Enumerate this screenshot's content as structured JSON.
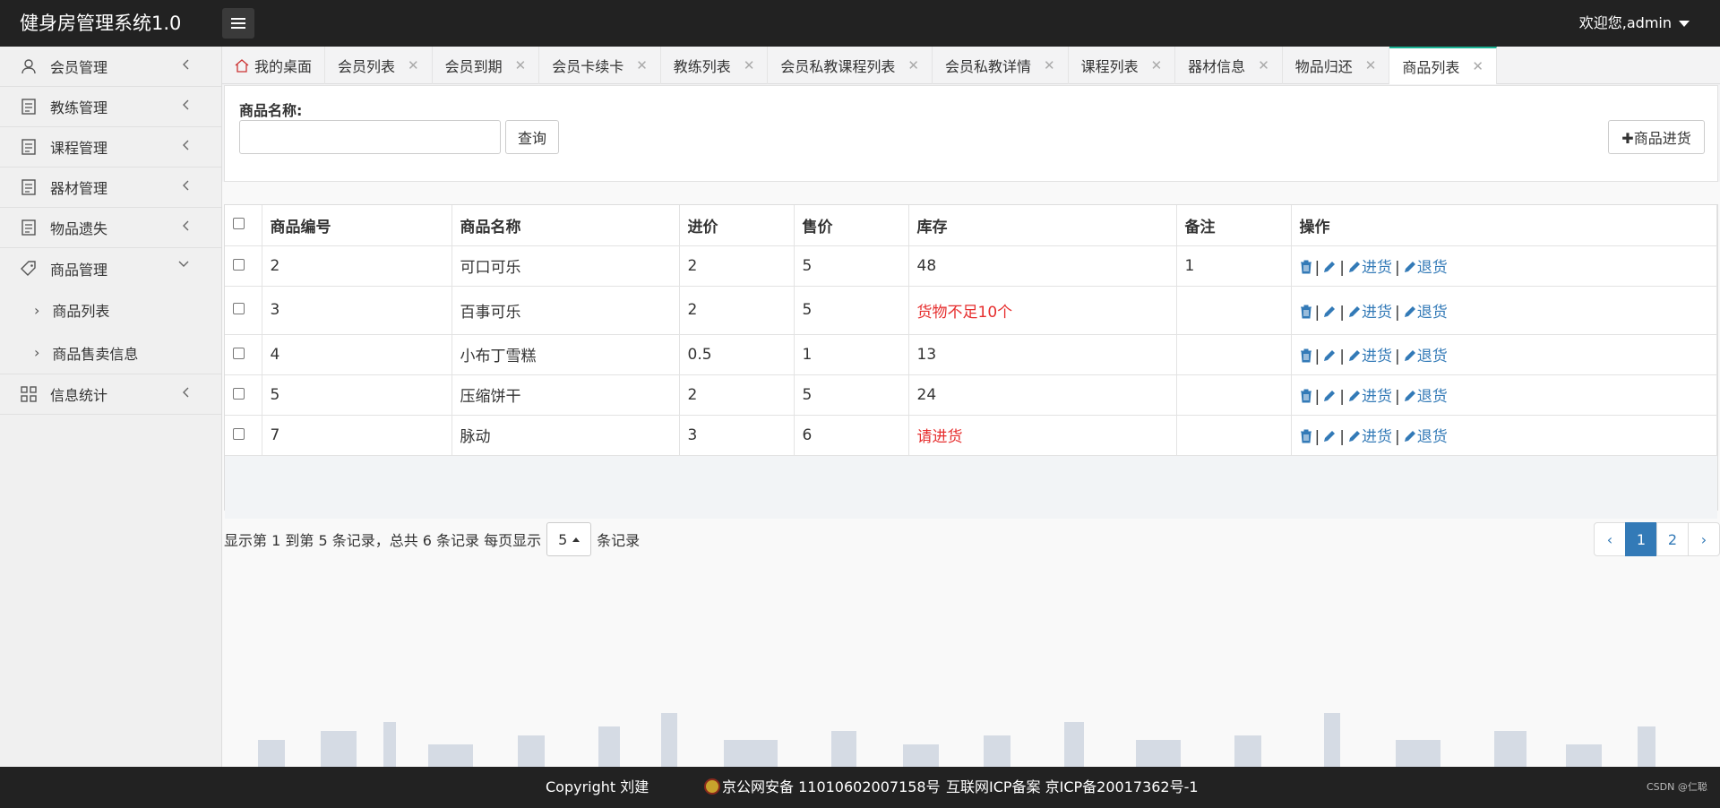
{
  "app": {
    "title": "健身房管理系统1.0",
    "user": "欢迎您,admin"
  },
  "sidebar": {
    "items": [
      {
        "label": "会员管理",
        "icon": "user-icon"
      },
      {
        "label": "教练管理",
        "icon": "document-icon"
      },
      {
        "label": "课程管理",
        "icon": "document-icon"
      },
      {
        "label": "器材管理",
        "icon": "document-icon"
      },
      {
        "label": "物品遗失",
        "icon": "document-icon"
      },
      {
        "label": "商品管理",
        "icon": "tag-icon",
        "expanded": true
      },
      {
        "label": "信息统计",
        "icon": "grid-icon"
      }
    ],
    "subitems": [
      {
        "label": "商品列表"
      },
      {
        "label": "商品售卖信息"
      }
    ]
  },
  "tabs": [
    {
      "label": "我的桌面"
    },
    {
      "label": "会员列表"
    },
    {
      "label": "会员到期"
    },
    {
      "label": "会员卡续卡"
    },
    {
      "label": "教练列表"
    },
    {
      "label": "会员私教课程列表"
    },
    {
      "label": "会员私教详情"
    },
    {
      "label": "课程列表"
    },
    {
      "label": "器材信息"
    },
    {
      "label": "物品归还"
    },
    {
      "label": "商品列表",
      "active": true
    }
  ],
  "search": {
    "label": "商品名称:",
    "value": "",
    "query_label": "查询",
    "restock_label": "✚商品进货"
  },
  "table": {
    "headers": [
      "商品编号",
      "商品名称",
      "进价",
      "售价",
      "库存",
      "备注",
      "操作"
    ],
    "rows": [
      {
        "id": "2",
        "name": "可口可乐",
        "cost": "2",
        "price": "5",
        "stock": "48",
        "stock_alert": false,
        "note": "1"
      },
      {
        "id": "3",
        "name": "百事可乐",
        "cost": "2",
        "price": "5",
        "stock": "货物不足10个",
        "stock_alert": true,
        "note": ""
      },
      {
        "id": "4",
        "name": "小布丁雪糕",
        "cost": "0.5",
        "price": "1",
        "stock": "13",
        "stock_alert": false,
        "note": ""
      },
      {
        "id": "5",
        "name": "压缩饼干",
        "cost": "2",
        "price": "5",
        "stock": "24",
        "stock_alert": false,
        "note": ""
      },
      {
        "id": "7",
        "name": "脉动",
        "cost": "3",
        "price": "6",
        "stock": "请进货",
        "stock_alert": true,
        "note": ""
      }
    ],
    "actions": {
      "restock": "进货",
      "return": "退货",
      "sep": "|"
    }
  },
  "pagination": {
    "info_prefix": "显示第 1 到第 5 条记录，总共 6 条记录 每页显示",
    "page_size": "5",
    "info_suffix": "条记录",
    "prev": "‹",
    "pages": [
      "1",
      "2"
    ],
    "current": "1",
    "next": "›"
  },
  "footer": {
    "copyright": "Copyright 刘建",
    "police": "京公网安备 11010602007158号",
    "icp": "互联网ICP备案 京ICP备20017362号-1",
    "watermark": "CSDN @仁聪"
  },
  "colors": {
    "topbar": "#222222",
    "accent": "#337ab7",
    "alert": "#e62e2e"
  }
}
